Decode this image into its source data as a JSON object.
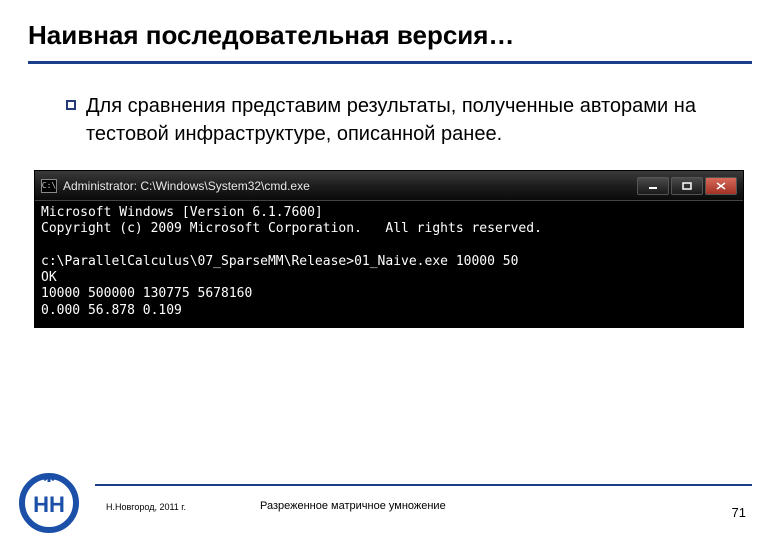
{
  "slide": {
    "heading": "Наивная последовательная версия…",
    "bullet": "Для сравнения представим результаты, полученные авторами на тестовой инфраструктуре, описанной ранее."
  },
  "cmd": {
    "icon_text": "C:\\",
    "title": "Administrator: C:\\Windows\\System32\\cmd.exe",
    "lines": [
      "Microsoft Windows [Version 6.1.7600]",
      "Copyright (c) 2009 Microsoft Corporation.   All rights reserved.",
      "",
      "c:\\ParallelCalculus\\07_SparseMM\\Release>01_Naive.exe 10000 50",
      "OK",
      "10000 500000 130775 5678160",
      "0.000 56.878 0.109"
    ]
  },
  "footer": {
    "location": "Н.Новгород, 2011 г.",
    "title": "Разреженное матричное умножение",
    "page": "71"
  }
}
